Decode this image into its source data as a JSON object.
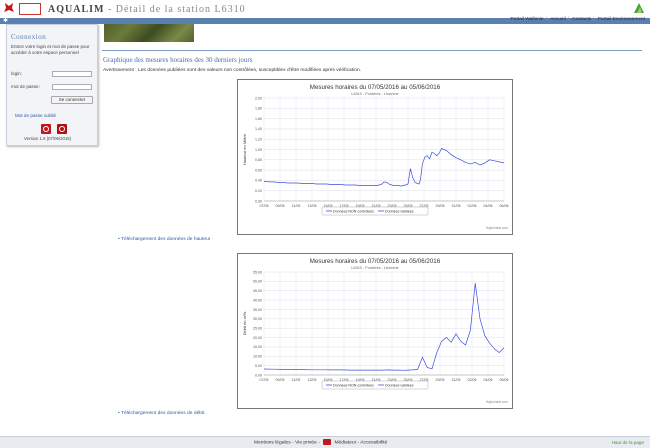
{
  "header": {
    "logo_text": "Wallonie",
    "logo2_text": "Service public de Wallonie",
    "app_name": "AQUALIM",
    "page_title": " - Détail de la station L6310"
  },
  "toplinks": [
    "Portail Wallonie",
    "Accueil",
    "Contacts",
    "Portail Environnement"
  ],
  "sidebar": {
    "title": "Connexion",
    "intro": "Entrez votre login et mot de passe pour accéder à votre espace personnel",
    "login_label": "login:",
    "password_label": "mot de passe:",
    "login_value": "",
    "password_value": "",
    "submit": "Se connecter",
    "forgot": "Mot de passe oublié",
    "version": "Version 1.6 (07/06/2015)"
  },
  "main": {
    "section_title": "Graphique des mesures horaires des 30 derniers jours",
    "warning": "Avertissement : Les données publiées sont des valeurs non contrôlées, susceptibles d'être modifiées après vérification.",
    "download_height": "Téléchargement des données de hauteur",
    "download_flow": "Téléchargement des données de débit"
  },
  "footer": {
    "legal": "Mentions légales",
    "privacy": "Vie privée",
    "mediator": "Médiateur",
    "accessibility": "Accessibilité",
    "top": "Haut de la page"
  },
  "colors": {
    "accent": "#5a7fb0",
    "line": "#3b4fd8",
    "top_link": "#3a9a3a"
  },
  "chart_data": [
    {
      "type": "line",
      "title": "Mesures horaires du 07/05/2016 au 05/06/2016",
      "subtitle": "L6310 - Forrières - Lhomme",
      "ylabel": "Hauteur en Mètre",
      "credit": "Highcharts.com",
      "ylim": [
        0,
        2
      ],
      "yticks": [
        "0,00",
        "0,20",
        "0,40",
        "0,60",
        "0,80",
        "1,00",
        "1,20",
        "1,40",
        "1,60",
        "1,80",
        "2,00"
      ],
      "xticks": [
        "07/05",
        "09/05",
        "11/05",
        "13/05",
        "15/05",
        "17/05",
        "19/05",
        "21/05",
        "23/05",
        "25/05",
        "27/05",
        "29/05",
        "31/05",
        "02/06",
        "04/06",
        "06/06"
      ],
      "legend": [
        "Données NON contrôlées",
        "Données validées"
      ],
      "series": [
        {
          "name": "Données NON contrôlées",
          "x": [
            0,
            1,
            2,
            3,
            4,
            5,
            6,
            7,
            8,
            9,
            10,
            11,
            12,
            13,
            14,
            15,
            16,
            17,
            18,
            19,
            20,
            21,
            22,
            23,
            23.5,
            24,
            24.6,
            25,
            25.6,
            26,
            26.6,
            27,
            27.6,
            28,
            28.5,
            29,
            29.5,
            30,
            30.5,
            31,
            31.5,
            32,
            32.3,
            32.6,
            33,
            33.5,
            34,
            34.5,
            35,
            35.5,
            36,
            36.5,
            37,
            38,
            39,
            40,
            41,
            42,
            43,
            44,
            45,
            46,
            47,
            48,
            49,
            50
          ],
          "y": [
            0.38,
            0.37,
            0.37,
            0.36,
            0.36,
            0.35,
            0.35,
            0.35,
            0.34,
            0.34,
            0.34,
            0.33,
            0.33,
            0.33,
            0.32,
            0.32,
            0.32,
            0.31,
            0.31,
            0.31,
            0.3,
            0.3,
            0.3,
            0.3,
            0.3,
            0.31,
            0.33,
            0.37,
            0.36,
            0.33,
            0.31,
            0.3,
            0.3,
            0.3,
            0.29,
            0.3,
            0.31,
            0.33,
            0.63,
            0.45,
            0.36,
            0.34,
            0.33,
            0.42,
            0.72,
            0.85,
            0.88,
            0.82,
            0.95,
            0.92,
            0.88,
            0.93,
            1.02,
            0.98,
            0.9,
            0.84,
            0.8,
            0.75,
            0.72,
            0.75,
            0.7,
            0.74,
            0.8,
            0.78,
            0.76,
            0.74
          ]
        }
      ]
    },
    {
      "type": "line",
      "title": "Mesures horaires du 07/05/2016 au 05/06/2016",
      "subtitle": "L6310 - Forrières - Lhomme",
      "ylabel": "Débit en m³/s",
      "credit": "Highcharts.com",
      "ylim": [
        0,
        55
      ],
      "yticks": [
        "0,00",
        "5,00",
        "10,00",
        "15,00",
        "20,00",
        "25,00",
        "30,00",
        "35,00",
        "40,00",
        "45,00",
        "50,00",
        "55,00"
      ],
      "xticks": [
        "07/05",
        "09/05",
        "11/05",
        "13/05",
        "15/05",
        "17/05",
        "19/05",
        "21/05",
        "23/05",
        "25/05",
        "27/05",
        "29/05",
        "31/05",
        "02/06",
        "04/06",
        "06/06"
      ],
      "legend": [
        "Données NON contrôlées",
        "Données validées"
      ],
      "series": [
        {
          "name": "Données NON contrôlées",
          "x": [],
          "y": []
        }
      ]
    }
  ]
}
